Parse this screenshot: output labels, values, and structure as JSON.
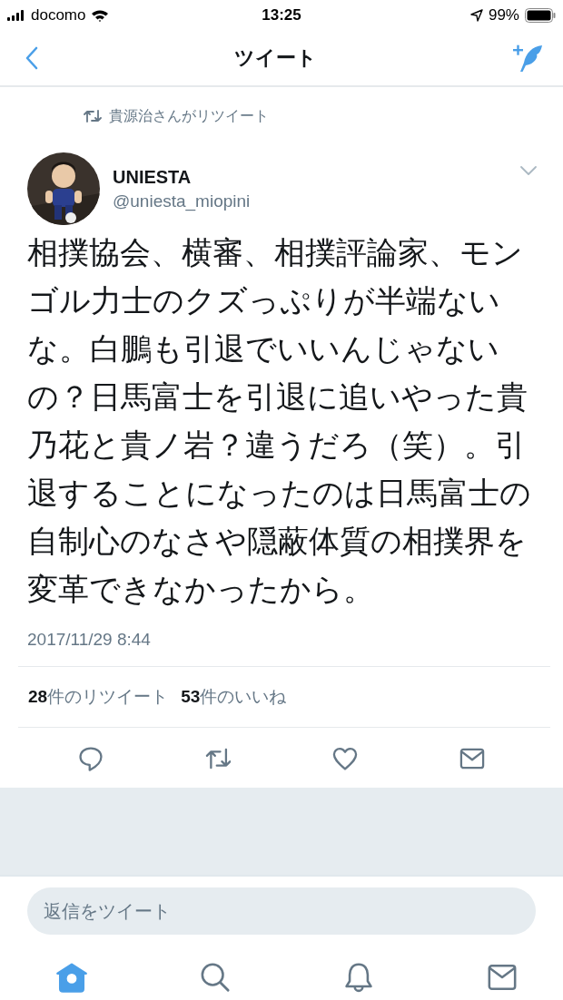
{
  "status_bar": {
    "carrier": "docomo",
    "time": "13:25",
    "battery": "99%"
  },
  "nav": {
    "title": "ツイート"
  },
  "retweet_note": "貴源治さんがリツイート",
  "tweet": {
    "author_name": "UNIESTA",
    "handle": "@uniesta_miopini",
    "text": "相撲協会、横審、相撲評論家、モンゴル力士のクズっぷりが半端ないな。白鵬も引退でいいんじゃないの？日馬富士を引退に追いやった貴乃花と貴ノ岩？違うだろ（笑）。引退することになったのは日馬富士の自制心のなさや隠蔽体質の相撲界を変革できなかったから。",
    "timestamp": "2017/11/29 8:44"
  },
  "stats": [
    {
      "count": "28",
      "label": "件のリツイート"
    },
    {
      "count": "53",
      "label": "件のいいね"
    }
  ],
  "actions": [
    {
      "kind": "reply"
    },
    {
      "kind": "retweet"
    },
    {
      "kind": "like"
    },
    {
      "kind": "message"
    }
  ],
  "reply_field": {
    "placeholder": "返信をツイート"
  },
  "tab_bar": [
    {
      "kind": "home",
      "selected": true
    },
    {
      "kind": "search",
      "selected": false
    },
    {
      "kind": "notifications",
      "selected": false
    },
    {
      "kind": "messages",
      "selected": false
    }
  ]
}
